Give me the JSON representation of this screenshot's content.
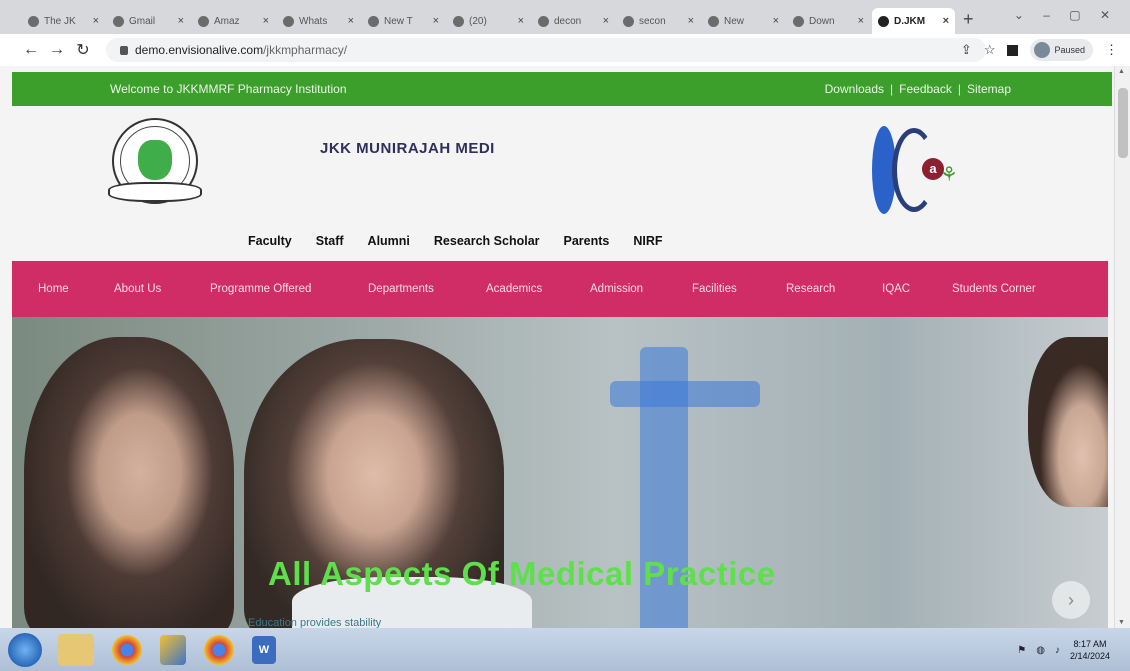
{
  "browser": {
    "tabs": [
      {
        "title": "The JK",
        "active": false
      },
      {
        "title": "Gmail",
        "active": false
      },
      {
        "title": "Amaz",
        "active": false
      },
      {
        "title": "Whats",
        "active": false
      },
      {
        "title": "New T",
        "active": false
      },
      {
        "title": "(20)",
        "active": false
      },
      {
        "title": "decon",
        "active": false
      },
      {
        "title": "secon",
        "active": false
      },
      {
        "title": "New",
        "active": false
      },
      {
        "title": "Down",
        "active": false
      },
      {
        "title": "D.JKM",
        "active": true
      }
    ],
    "new_tab_symbol": "+",
    "close_symbol": "×",
    "url_host": "demo.envisionalive.com",
    "url_path": "/jkkmpharmacy/",
    "profile_status": "Paused"
  },
  "site": {
    "welcome_text": "Welcome to JKKMMRF Pharmacy Institution",
    "top_links": [
      "Downloads",
      "|",
      "Feedback",
      "|",
      "Sitemap"
    ],
    "site_title": "JKK MUNIRAJAH MEDI",
    "subnav": [
      "Faculty",
      "Staff",
      "Alumni",
      "Research Scholar",
      "Parents",
      "NIRF"
    ],
    "mainnav": [
      "Home",
      "About Us",
      "Programme Offered",
      "Departments",
      "Academics",
      "Admission",
      "Facilities",
      "Research",
      "IQAC",
      "Students Corner"
    ],
    "hero_title": "All Aspects Of Medical Practice",
    "hero_subtitle": "Education provides stability",
    "badge_letter": "a",
    "colors": {
      "topbar_green": "#3c9f2c",
      "nav_pink": "#d02d67",
      "hero_title_green": "#5ee04c"
    }
  },
  "taskbar": {
    "time": "8:17 AM",
    "date": "2/14/2024"
  }
}
